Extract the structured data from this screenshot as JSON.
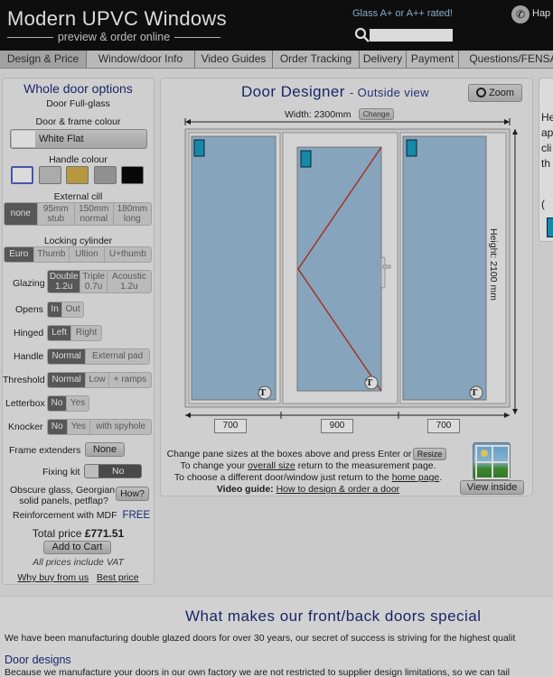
{
  "header": {
    "title": "Modern UPVC Windows",
    "subtitle": "preview & order online",
    "glass_rated": "Glass A+ or A++ rated!",
    "phone_text": "Hap",
    "search_value": ""
  },
  "nav": {
    "tabs": [
      {
        "label": "Design & Price",
        "active": true
      },
      {
        "label": "Window/door Info",
        "active": false
      },
      {
        "label": "Video Guides",
        "active": false
      },
      {
        "label": "Order Tracking",
        "active": false
      },
      {
        "label": "Delivery",
        "active": false
      },
      {
        "label": "Payment",
        "active": false
      },
      {
        "label": "Questions/FENSA",
        "active": false
      }
    ]
  },
  "options": {
    "heading": "Whole door options",
    "door_type": "Door Full-glass",
    "frame_colour_label": "Door & frame colour",
    "frame_colour_value": "White Flat",
    "handle_colour_label": "Handle colour",
    "handle_swatches": [
      "#ffffff",
      "#c8c8c8",
      "#d4b24c",
      "#a8a8a8",
      "#0a0a0a"
    ],
    "cill_label": "External cill",
    "cill_options": [
      {
        "line1": "none",
        "line2": "",
        "selected": true
      },
      {
        "line1": "95mm",
        "line2": "stub",
        "selected": false
      },
      {
        "line1": "150mm",
        "line2": "normal",
        "selected": false
      },
      {
        "line1": "180mm",
        "line2": "long",
        "selected": false
      }
    ],
    "cylinder_label": "Locking cylinder",
    "cylinder_options": [
      {
        "label": "Euro",
        "selected": true
      },
      {
        "label": "Thumb",
        "selected": false
      },
      {
        "label": "Ultion",
        "selected": false
      },
      {
        "label": "U+thumb",
        "selected": false
      }
    ],
    "glazing_label": "Glazing",
    "glazing_options": [
      {
        "line1": "Double",
        "line2": "1.2u",
        "selected": true
      },
      {
        "line1": "Triple",
        "line2": "0.7u",
        "selected": false
      },
      {
        "line1": "Acoustic",
        "line2": "1.2u",
        "selected": false
      }
    ],
    "opens_label": "Opens",
    "opens_options": [
      {
        "label": "In",
        "selected": true
      },
      {
        "label": "Out",
        "selected": false
      }
    ],
    "hinged_label": "Hinged",
    "hinged_options": [
      {
        "label": "Left",
        "selected": true
      },
      {
        "label": "Right",
        "selected": false
      }
    ],
    "handle_label": "Handle",
    "handle_options": [
      {
        "label": "Normal",
        "selected": true
      },
      {
        "label": "External pad",
        "selected": false
      }
    ],
    "threshold_label": "Threshold",
    "threshold_options": [
      {
        "label": "Normal",
        "selected": true
      },
      {
        "label": "Low",
        "selected": false
      },
      {
        "label": "+ ramps",
        "selected": false
      }
    ],
    "letterbox_label": "Letterbox",
    "letterbox_options": [
      {
        "label": "No",
        "selected": true
      },
      {
        "label": "Yes",
        "selected": false
      }
    ],
    "knocker_label": "Knocker",
    "knocker_options": [
      {
        "label": "No",
        "selected": true
      },
      {
        "label": "Yes",
        "selected": false
      },
      {
        "label": "with spyhole",
        "selected": false
      }
    ],
    "frame_extenders_label": "Frame extenders",
    "frame_extenders_value": "None",
    "fixing_kit_label": "Fixing kit",
    "fixing_kit_value": "No",
    "obscure_line1": "Obscure glass, Georgian,",
    "obscure_line2": "solid panels, petflap?",
    "how_button": "How?",
    "reinforcement_label": "Reinforcement with MDF",
    "reinforcement_value": "FREE",
    "total_label": "Total price",
    "total_value": "£771.51",
    "add_to_cart": "Add to Cart",
    "vat_note": "All prices include VAT",
    "why_buy": "Why buy from us",
    "best_price": "Best price"
  },
  "designer": {
    "title": "Door Designer",
    "view": "- Outside view",
    "zoom_label": "Zoom",
    "width_label": "Width: 2300mm",
    "change_label": "Change",
    "height_label": "Height: 2100 mm",
    "pane_sizes": [
      "700",
      "900",
      "700"
    ],
    "pane_marker": "T",
    "instr_line1": "Change pane sizes at the boxes above and press Enter or",
    "resize_label": "Resize",
    "instr_line2_pre": "To change your",
    "instr_line2_link": "overall size",
    "instr_line2_post": "return to the measurement page.",
    "instr_line3_pre": "To choose a different door/window just return to the",
    "instr_line3_link": "home page",
    "video_guide_label": "Video guide:",
    "video_guide_link": "How to design & order a door",
    "view_inside": "View inside"
  },
  "side_panel": {
    "lines": [
      "He",
      "ap",
      "cli",
      "th"
    ],
    "extra": "("
  },
  "bottom": {
    "heading": "What makes our front/back doors special",
    "para1": "We have been manufacturing double glazed doors for over 30 years, our secret of success is striving for the highest qualit",
    "subheading": "Door designs",
    "para2": "Because we manufacture your doors in our own factory we are not restricted to supplier design limitations, so we can tail"
  },
  "colors": {
    "accent": "#1f2d7a",
    "glass": "#9cc1dc",
    "opening_line": "#c0392b",
    "selected": "#666666"
  }
}
